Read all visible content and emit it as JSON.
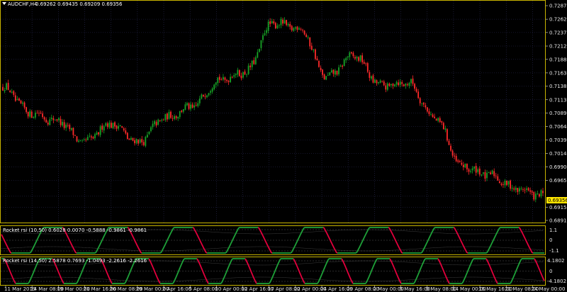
{
  "colors": {
    "background": "#000000",
    "grid": "#2c2c58",
    "bull": "#17a326",
    "bear": "#ff2a2a",
    "frame": "#c8b400",
    "text": "#e6e6e6",
    "osc_bull": "#1fa53a",
    "osc_bear": "#e8003e",
    "price_tag_bg": "#ffe600",
    "price_tag_fg": "#000000"
  },
  "header": {
    "arrow_icon": "triangle-down-icon",
    "symbol": "AUDCHF,H4",
    "ohlc": "0.69262 0.69435 0.69209 0.69356"
  },
  "price_axis": {
    "ticks": [
      "0.72870",
      "0.72620",
      "0.72375",
      "0.72125",
      "0.71880",
      "0.71630",
      "0.71385",
      "0.71135",
      "0.70890",
      "0.70640",
      "0.70395",
      "0.70145",
      "0.69900",
      "0.69650",
      "0.69356",
      "0.69155",
      "0.68910"
    ],
    "current": "0.69356"
  },
  "indicator1": {
    "title": "Rocket rsi (10,50) 0.6028 0.0070 -0.5888 -0.9861 -0.9861",
    "ticks": [
      "1.1",
      "0",
      "-1.1"
    ]
  },
  "indicator2": {
    "title": "Rocket rsi (14,50) 2.5878 0.7693 -1.0493 -2.2616 -2.2616",
    "ticks": [
      "4.1802",
      "0",
      "-4.1802"
    ]
  },
  "time_axis": [
    "11 Mar 2019",
    "14 Mar 08:00",
    "19 Mar 00:00",
    "21 Mar 16:00",
    "26 Mar 08:00",
    "29 Mar 00:00",
    "2 Apr 16:00",
    "5 Apr 08:00",
    "10 Apr 00:00",
    "12 Apr 16:00",
    "17 Apr 08:00",
    "22 Apr 00:00",
    "24 Apr 16:00",
    "29 Apr 08:00",
    "2 May 00:00",
    "6 May 16:00",
    "9 May 08:00",
    "14 May 00:00",
    "16 May 16:00",
    "21 May 08:00",
    "24 May 00:00"
  ],
  "chart_data": {
    "type": "candlestick",
    "symbol": "AUDCHF",
    "timeframe": "H4",
    "ylim": [
      0.6891,
      0.7287
    ],
    "close_path": [
      {
        "x": "11 Mar 2019",
        "y": 0.7136
      },
      {
        "x": "14 Mar 08:00",
        "y": 0.709
      },
      {
        "x": "19 Mar 00:00",
        "y": 0.7075
      },
      {
        "x": "21 Mar 16:00",
        "y": 0.7035
      },
      {
        "x": "26 Mar 08:00",
        "y": 0.707
      },
      {
        "x": "29 Mar 00:00",
        "y": 0.7035
      },
      {
        "x": "2 Apr 16:00",
        "y": 0.708
      },
      {
        "x": "5 Apr 08:00",
        "y": 0.71
      },
      {
        "x": "10 Apr 00:00",
        "y": 0.715
      },
      {
        "x": "12 Apr 16:00",
        "y": 0.7165
      },
      {
        "x": "17 Apr 08:00",
        "y": 0.7255
      },
      {
        "x": "22 Apr 00:00",
        "y": 0.7245
      },
      {
        "x": "24 Apr 16:00",
        "y": 0.7155
      },
      {
        "x": "29 Apr 08:00",
        "y": 0.7195
      },
      {
        "x": "2 May 00:00",
        "y": 0.714
      },
      {
        "x": "6 May 16:00",
        "y": 0.7145
      },
      {
        "x": "9 May 08:00",
        "y": 0.708
      },
      {
        "x": "14 May 00:00",
        "y": 0.699
      },
      {
        "x": "16 May 16:00",
        "y": 0.6975
      },
      {
        "x": "21 May 08:00",
        "y": 0.695
      },
      {
        "x": "24 May 00:00",
        "y": 0.6936
      }
    ],
    "indicators": [
      {
        "name": "Rocket rsi (10,50)",
        "values": [
          0.6028,
          0.007,
          -0.5888,
          -0.9861,
          -0.9861
        ],
        "range": [
          -1.1,
          1.1
        ]
      },
      {
        "name": "Rocket rsi (14,50)",
        "values": [
          2.5878,
          0.7693,
          -1.0493,
          -2.2616,
          -2.2616
        ],
        "range": [
          -4.1802,
          4.1802
        ]
      }
    ]
  }
}
